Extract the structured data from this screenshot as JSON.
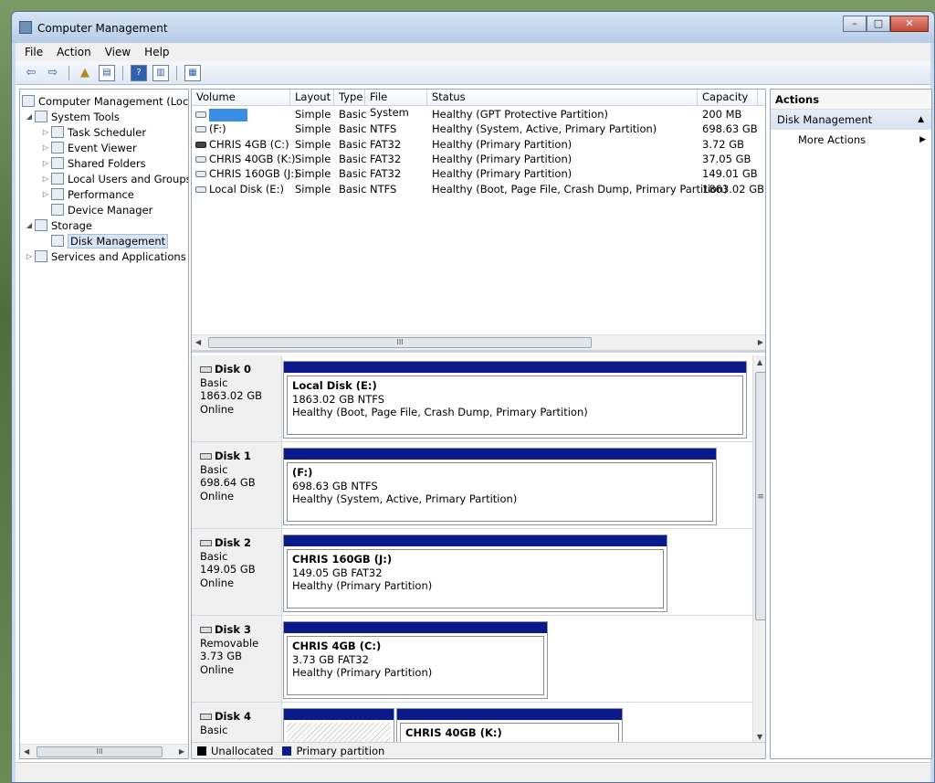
{
  "window": {
    "title": "Computer Management"
  },
  "menu": [
    "File",
    "Action",
    "View",
    "Help"
  ],
  "tree": {
    "items": [
      {
        "label": "Computer Management (Local"
      },
      {
        "label": "System Tools"
      },
      {
        "label": "Task Scheduler"
      },
      {
        "label": "Event Viewer"
      },
      {
        "label": "Shared Folders"
      },
      {
        "label": "Local Users and Groups"
      },
      {
        "label": "Performance"
      },
      {
        "label": "Device Manager"
      },
      {
        "label": "Storage"
      },
      {
        "label": "Disk Management"
      },
      {
        "label": "Services and Applications"
      }
    ],
    "scroll_label": "III"
  },
  "volumes": {
    "columns": [
      "Volume",
      "Layout",
      "Type",
      "File System",
      "Status",
      "Capacity"
    ],
    "rows": [
      {
        "volume": "",
        "layout": "Simple",
        "type": "Basic",
        "fs": "",
        "status": "Healthy (GPT Protective Partition)",
        "capacity": "200 MB"
      },
      {
        "volume": "(F:)",
        "layout": "Simple",
        "type": "Basic",
        "fs": "NTFS",
        "status": "Healthy (System, Active, Primary Partition)",
        "capacity": "698.63 GB"
      },
      {
        "volume": "CHRIS 4GB (C:)",
        "layout": "Simple",
        "type": "Basic",
        "fs": "FAT32",
        "status": "Healthy (Primary Partition)",
        "capacity": "3.72 GB"
      },
      {
        "volume": "CHRIS 40GB (K:)",
        "layout": "Simple",
        "type": "Basic",
        "fs": "FAT32",
        "status": "Healthy (Primary Partition)",
        "capacity": "37.05 GB"
      },
      {
        "volume": "CHRIS 160GB (J:)",
        "layout": "Simple",
        "type": "Basic",
        "fs": "FAT32",
        "status": "Healthy (Primary Partition)",
        "capacity": "149.01 GB"
      },
      {
        "volume": "Local Disk (E:)",
        "layout": "Simple",
        "type": "Basic",
        "fs": "NTFS",
        "status": "Healthy (Boot, Page File, Crash Dump, Primary Partition)",
        "capacity": "1863.02 GB"
      }
    ],
    "scroll_label": "III"
  },
  "disks": [
    {
      "name": "Disk 0",
      "type": "Basic",
      "size": "1863.02 GB",
      "state": "Online",
      "part": {
        "name": "Local Disk  (E:)",
        "size": "1863.02 GB NTFS",
        "status": "Healthy (Boot, Page File, Crash Dump, Primary Partition)"
      }
    },
    {
      "name": "Disk 1",
      "type": "Basic",
      "size": "698.64 GB",
      "state": "Online",
      "part": {
        "name": " (F:)",
        "size": "698.63 GB NTFS",
        "status": "Healthy (System, Active, Primary Partition)"
      }
    },
    {
      "name": "Disk 2",
      "type": "Basic",
      "size": "149.05 GB",
      "state": "Online",
      "part": {
        "name": "CHRIS 160GB  (J:)",
        "size": "149.05 GB FAT32",
        "status": "Healthy (Primary Partition)"
      }
    },
    {
      "name": "Disk 3",
      "type": "Removable",
      "size": "3.73 GB",
      "state": "Online",
      "part": {
        "name": "CHRIS 4GB  (C:)",
        "size": "3.73 GB FAT32",
        "status": "Healthy (Primary Partition)"
      }
    },
    {
      "name": "Disk 4",
      "type": "Basic",
      "size": "",
      "state": "",
      "part": {
        "name": "CHRIS 40GB  (K:)",
        "size": "",
        "status": ""
      }
    }
  ],
  "disk_scroll_label": "≡",
  "legend": {
    "unallocated": "Unallocated",
    "primary": "Primary partition"
  },
  "colors": {
    "primary_partition": "#0a1a8a",
    "unallocated": "#000000",
    "selection": "#3a8ee6"
  },
  "actions": {
    "header": "Actions",
    "section": "Disk Management",
    "more": "More Actions"
  },
  "icons": {
    "back": "back-arrow-icon",
    "forward": "forward-arrow-icon",
    "up": "up-folder-icon",
    "help": "help-icon"
  }
}
